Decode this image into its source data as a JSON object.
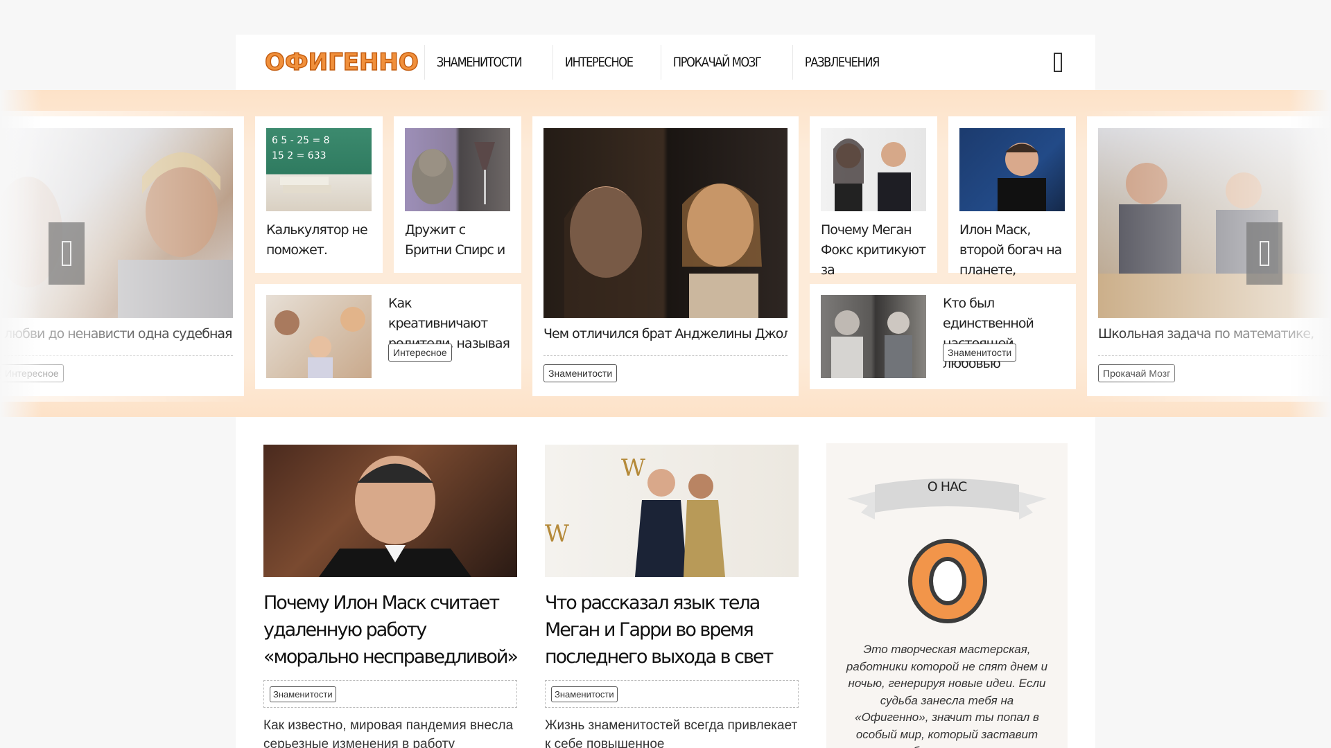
{
  "logo": "ОФИГЕННО",
  "nav": [
    "ЗНАМЕНИТОСТИ",
    "ИНТЕРЕСНОЕ",
    "ПРОКАЧАЙ МОЗГ",
    "РАЗВЛЕЧЕНИЯ"
  ],
  "carousel": {
    "left_card": {
      "title": "любви до ненависти одна судебная",
      "tag": "Интересное"
    },
    "small_cards": [
      {
        "title": "Калькулятор не поможет."
      },
      {
        "title": "Дружит с Бритни Спирс и"
      },
      {
        "title": "Почему Меган Фокс критикуют за"
      },
      {
        "title": "Илон Маск, второй богач на планете,"
      }
    ],
    "wide_cards": [
      {
        "title": "Как креативничают родители, называя",
        "tag": "Интересное"
      },
      {
        "title": "Кто был единственной настоящей любовью",
        "tag": "Знаменитости"
      }
    ],
    "center_card": {
      "title": "Чем отличился брат Анджелины Джоли и",
      "tag": "Знаменитости"
    },
    "right_card": {
      "title": "Школьная задача по математике,",
      "tag": "Прокачай Мозг"
    }
  },
  "posts": [
    {
      "title": "Почему Илон Маск считает удаленную работу «морально несправедливой»",
      "tag": "Знаменитости",
      "excerpt": "Как известно, мировая пандемия внесла серьезные изменения в работу"
    },
    {
      "title": "Что рассказал язык тела Меган и Гарри во время последнего выхода в свет",
      "tag": "Знаменитости",
      "excerpt": "Жизнь знаменитостей всегда привлекает к себе повышенное"
    }
  ],
  "about": {
    "heading": "О НАС",
    "letter": "О",
    "text": "Это творческая мастерская, работники которой не спят днем и ночью, генерируя новые идеи. Если судьба занесла тебя на «Офигенно», значит ты попал в особый мир, который заставит тебя переживать"
  },
  "colors": {
    "brand_orange": "#f0903c",
    "band": "#fdebd9"
  }
}
